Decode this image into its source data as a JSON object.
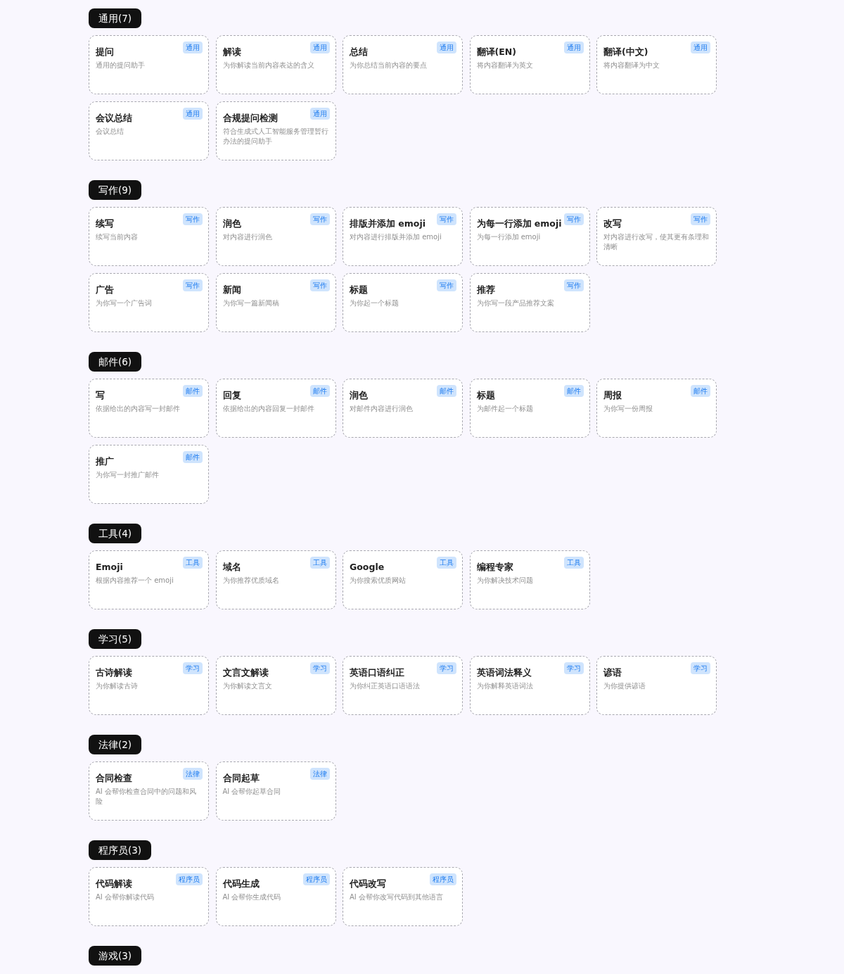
{
  "categories": [
    {
      "label": "通用(7)",
      "items": [
        {
          "title": "提问",
          "tag": "通用",
          "desc": "通用的提问助手"
        },
        {
          "title": "解读",
          "tag": "通用",
          "desc": "为你解读当前内容表达的含义"
        },
        {
          "title": "总结",
          "tag": "通用",
          "desc": "为你总结当前内容的要点"
        },
        {
          "title": "翻译(EN)",
          "tag": "通用",
          "desc": "将内容翻译为英文"
        },
        {
          "title": "翻译(中文)",
          "tag": "通用",
          "desc": "将内容翻译为中文"
        },
        {
          "title": "会议总结",
          "tag": "通用",
          "desc": "会议总结"
        },
        {
          "title": "合规提问检测",
          "tag": "通用",
          "desc": "符合生成式人工智能服务管理暂行办法的提问助手"
        }
      ]
    },
    {
      "label": "写作(9)",
      "items": [
        {
          "title": "续写",
          "tag": "写作",
          "desc": "续写当前内容"
        },
        {
          "title": "润色",
          "tag": "写作",
          "desc": "对内容进行润色"
        },
        {
          "title": "排版并添加 emoji",
          "tag": "写作",
          "desc": "对内容进行排版并添加 emoji"
        },
        {
          "title": "为每一行添加 emoji",
          "tag": "写作",
          "desc": "为每一行添加 emoji"
        },
        {
          "title": "改写",
          "tag": "写作",
          "desc": "对内容进行改写，使其更有条理和清晰"
        },
        {
          "title": "广告",
          "tag": "写作",
          "desc": "为你写一个广告词"
        },
        {
          "title": "新闻",
          "tag": "写作",
          "desc": "为你写一篇新闻稿"
        },
        {
          "title": "标题",
          "tag": "写作",
          "desc": "为你起一个标题"
        },
        {
          "title": "推荐",
          "tag": "写作",
          "desc": "为你写一段产品推荐文案"
        }
      ]
    },
    {
      "label": "邮件(6)",
      "items": [
        {
          "title": "写",
          "tag": "邮件",
          "desc": "依据给出的内容写一封邮件"
        },
        {
          "title": "回复",
          "tag": "邮件",
          "desc": "依据给出的内容回复一封邮件"
        },
        {
          "title": "润色",
          "tag": "邮件",
          "desc": "对邮件内容进行润色"
        },
        {
          "title": "标题",
          "tag": "邮件",
          "desc": "为邮件起一个标题"
        },
        {
          "title": "周报",
          "tag": "邮件",
          "desc": "为你写一份周报"
        },
        {
          "title": "推广",
          "tag": "邮件",
          "desc": "为你写一封推广邮件"
        }
      ]
    },
    {
      "label": "工具(4)",
      "items": [
        {
          "title": "Emoji",
          "tag": "工具",
          "desc": "根据内容推荐一个 emoji"
        },
        {
          "title": "域名",
          "tag": "工具",
          "desc": "为你推荐优质域名"
        },
        {
          "title": "Google",
          "tag": "工具",
          "desc": "为你搜索优质网站"
        },
        {
          "title": "编程专家",
          "tag": "工具",
          "desc": "为你解决技术问题"
        }
      ]
    },
    {
      "label": "学习(5)",
      "items": [
        {
          "title": "古诗解读",
          "tag": "学习",
          "desc": "为你解读古诗"
        },
        {
          "title": "文言文解读",
          "tag": "学习",
          "desc": "为你解读文言文"
        },
        {
          "title": "英语口语纠正",
          "tag": "学习",
          "desc": "为你纠正英语口语语法"
        },
        {
          "title": "英语词法释义",
          "tag": "学习",
          "desc": "为你解释英语词法"
        },
        {
          "title": "谚语",
          "tag": "学习",
          "desc": "为你提供谚语"
        }
      ]
    },
    {
      "label": "法律(2)",
      "items": [
        {
          "title": "合同检查",
          "tag": "法律",
          "desc": "AI 会帮你检查合同中的问题和风险"
        },
        {
          "title": "合同起草",
          "tag": "法律",
          "desc": "AI 会帮你起草合同"
        }
      ]
    },
    {
      "label": "程序员(3)",
      "items": [
        {
          "title": "代码解读",
          "tag": "程序员",
          "desc": "AI 会帮你解读代码"
        },
        {
          "title": "代码生成",
          "tag": "程序员",
          "desc": "AI 会帮你生成代码"
        },
        {
          "title": "代码改写",
          "tag": "程序员",
          "desc": "AI 会帮你改写代码到其他语言"
        }
      ]
    },
    {
      "label": "游戏(3)"
    }
  ]
}
